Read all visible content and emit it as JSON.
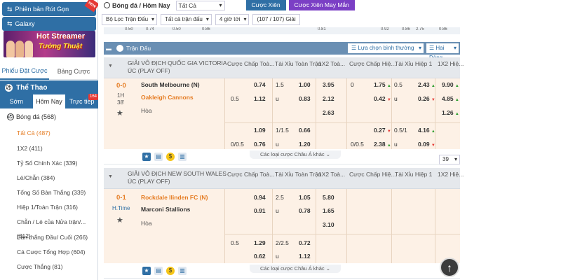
{
  "sidebar": {
    "promo1": "Phiên bản Rút Gọn",
    "promo1_badge": "NEW",
    "promo2": "Galaxy",
    "banner": {
      "line1": "Hot Streamer",
      "line2": "Tường Thuật"
    },
    "bet_tabs": [
      "Phiếu Đặt Cược",
      "Bảng Cược"
    ],
    "sport_header": "Thể Thao",
    "time_tabs": [
      "Sớm",
      "Hôm Nay",
      "Trực tiếp"
    ],
    "live_count": "164",
    "sport": {
      "label": "Bóng đá",
      "count": "(568)"
    },
    "menu": [
      {
        "label": "Tất Cả",
        "count": "(487)"
      },
      {
        "label": "1X2",
        "count": "(411)"
      },
      {
        "label": "Tỷ Số Chính Xác",
        "count": "(339)"
      },
      {
        "label": "Lẻ/Chẵn",
        "count": "(384)"
      },
      {
        "label": "Tổng Số Bàn Thắng",
        "count": "(339)"
      },
      {
        "label": "Hiệp 1/Toàn Trận",
        "count": "(316)"
      },
      {
        "label": "Chẵn / Lẻ của Nửa trận/...",
        "count": "(312)"
      },
      {
        "label": "Bàn thắng Đầu/ Cuối",
        "count": "(266)"
      },
      {
        "label": "Cá Cược Tổng Hợp",
        "count": "(604)"
      },
      {
        "label": "Cược Thắng",
        "count": "(81)"
      }
    ]
  },
  "header": {
    "title": "Bóng đá / Hôm Nay",
    "sport_select": "Tất Cả",
    "btn_xien": "Cược Xiên",
    "btn_may_man": "Cược Xiên May Mắn"
  },
  "filters": {
    "league_filter": "Bộ Lọc Trận Đấu",
    "match_filter": "Tất cả trận đấu",
    "time_filter": "4 giờ tới",
    "count": "(107 / 107) Giải"
  },
  "prev_strip": [
    "0.50",
    "0.74",
    "0.50",
    "0.86",
    "0.81",
    "0.92",
    "0.86",
    "2.75",
    "0.86"
  ],
  "section": {
    "title": "Trận Đấu",
    "sort": "Lựa chọn bình thường",
    "odds_type": "Hai Dòng"
  },
  "columns": [
    "Cược Chấp Toà...",
    "Tài Xỉu Toàn Trận",
    "1X2 Toà...",
    "Cược Chấp Hiệ...",
    "Tài Xỉu Hiệp 1",
    "1X2 Hiệ..."
  ],
  "leagues": [
    {
      "name": "GIẢI VÔ ĐỊCH QUỐC GIA VICTORIA ÚC (PLAY OFF)",
      "score": "0-0",
      "half": "1H",
      "minute": "38'",
      "home": "South Melbourne (N)",
      "away": "Oakleigh Cannons",
      "draw": "Hòa",
      "row1": {
        "ah_home": "0.74",
        "ou_line": "1.5",
        "ou_home": "1.00",
        "x12_home": "3.95",
        "h_ah_line": "0",
        "h_ah_home": "1.75",
        "h_ou_line": "0.5",
        "h_ou_home": "2.43",
        "h_x12_home": "9.90"
      },
      "row2": {
        "ah_line": "0.5",
        "ah_away": "1.12",
        "ou_u": "u",
        "ou_away": "0.83",
        "x12_away": "2.12",
        "h_ah_away": "0.42",
        "h_ou_u": "u",
        "h_ou_away": "0.26",
        "h_x12_away": "4.85"
      },
      "row3": {
        "x12_draw": "2.63",
        "h_x12_draw": "1.26"
      },
      "alt1": {
        "ah_home": "1.09",
        "ou_line": "1/1.5",
        "ou_home": "0.66",
        "h_ah_home": "0.27",
        "h_ou_line": "0.5/1",
        "h_ou_home": "4.16"
      },
      "alt2": {
        "ah_line": "0/0.5",
        "ah_away": "0.76",
        "ou_u": "u",
        "ou_away": "1.20",
        "h_ah_line": "0/0.5",
        "h_ah_away": "2.38",
        "h_ou_u": "u",
        "h_ou_away": "0.09"
      },
      "more": "Các loại cược Châu Á khác"
    },
    {
      "name": "GIẢI VÔ ĐỊCH NEW SOUTH WALES ÚC (PLAY OFF)",
      "score": "0-1",
      "half": "H.Time",
      "home": "Rockdale Ilinden FC (N)",
      "away": "Marconi Stallions",
      "draw": "Hòa",
      "row1": {
        "ah_home": "0.94",
        "ou_line": "2.5",
        "ou_home": "1.05",
        "x12_home": "5.80"
      },
      "row2": {
        "ah_away": "0.91",
        "ou_u": "u",
        "ou_away": "0.78",
        "x12_away": "1.65"
      },
      "row3": {
        "x12_draw": "3.10"
      },
      "alt1": {
        "ah_line": "0.5",
        "ah_home": "1.29",
        "ou_line": "2/2.5",
        "ou_home": "0.72"
      },
      "alt2": {
        "ah_away": "0.62",
        "ou_u": "u",
        "ou_away": "1.12"
      },
      "more": "Các loại cược Châu Á khác"
    }
  ],
  "page_select": "39",
  "colors": {
    "accent": "#2f6fa5",
    "orange": "#e57c23",
    "purple": "#7b3fc5",
    "row_bg": "#fdf1e6"
  }
}
